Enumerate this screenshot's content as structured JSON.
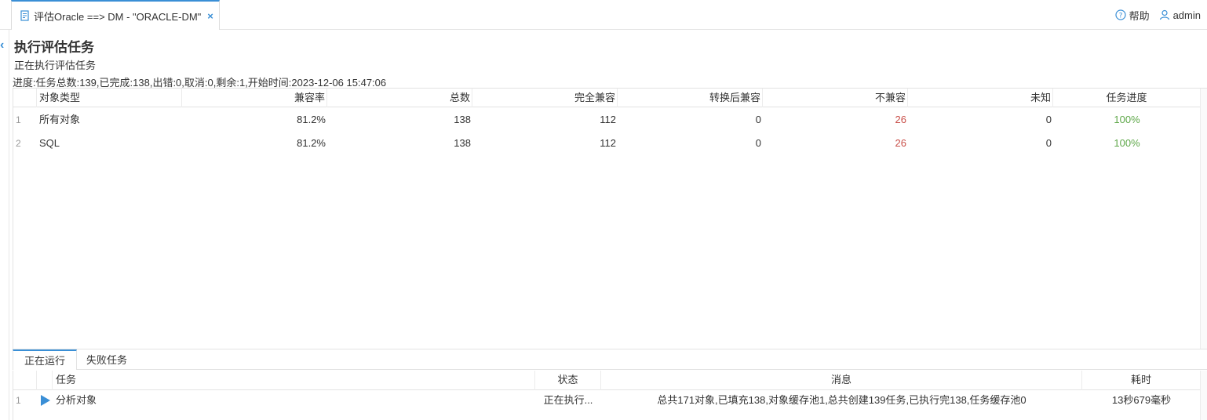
{
  "tab": {
    "title": "评估Oracle ==> DM - \"ORACLE-DM\"",
    "close": "×"
  },
  "header": {
    "help_label": "帮助",
    "user_label": "admin"
  },
  "page": {
    "title": "执行评估任务",
    "subtitle": "正在执行评估任务",
    "progress": "进度:任务总数:139,已完成:138,出错:0,取消:0,剩余:1,开始时间:2023-12-06 15:47:06"
  },
  "summary_table": {
    "columns": [
      "对象类型",
      "兼容率",
      "总数",
      "完全兼容",
      "转换后兼容",
      "不兼容",
      "未知",
      "任务进度"
    ],
    "rows": [
      {
        "num": "1",
        "type": "所有对象",
        "rate": "81.2%",
        "total": "138",
        "full": "112",
        "converted": "0",
        "incompatible": "26",
        "unknown": "0",
        "progress": "100%"
      },
      {
        "num": "2",
        "type": "SQL",
        "rate": "81.2%",
        "total": "138",
        "full": "112",
        "converted": "0",
        "incompatible": "26",
        "unknown": "0",
        "progress": "100%"
      }
    ]
  },
  "lower_tabs": {
    "running": "正在运行",
    "failed": "失败任务"
  },
  "task_table": {
    "columns": [
      "任务",
      "状态",
      "消息",
      "耗时"
    ],
    "rows": [
      {
        "num": "1",
        "task": "分析对象",
        "status": "正在执行...",
        "message": "总共171对象,已填充138,对象缓存池1,总共创建139任务,已执行完138,任务缓存池0",
        "elapsed": "13秒679毫秒"
      }
    ]
  },
  "colors": {
    "accent": "#3a8fd6",
    "incompatible": "#c9504a",
    "done": "#5fa84a"
  }
}
